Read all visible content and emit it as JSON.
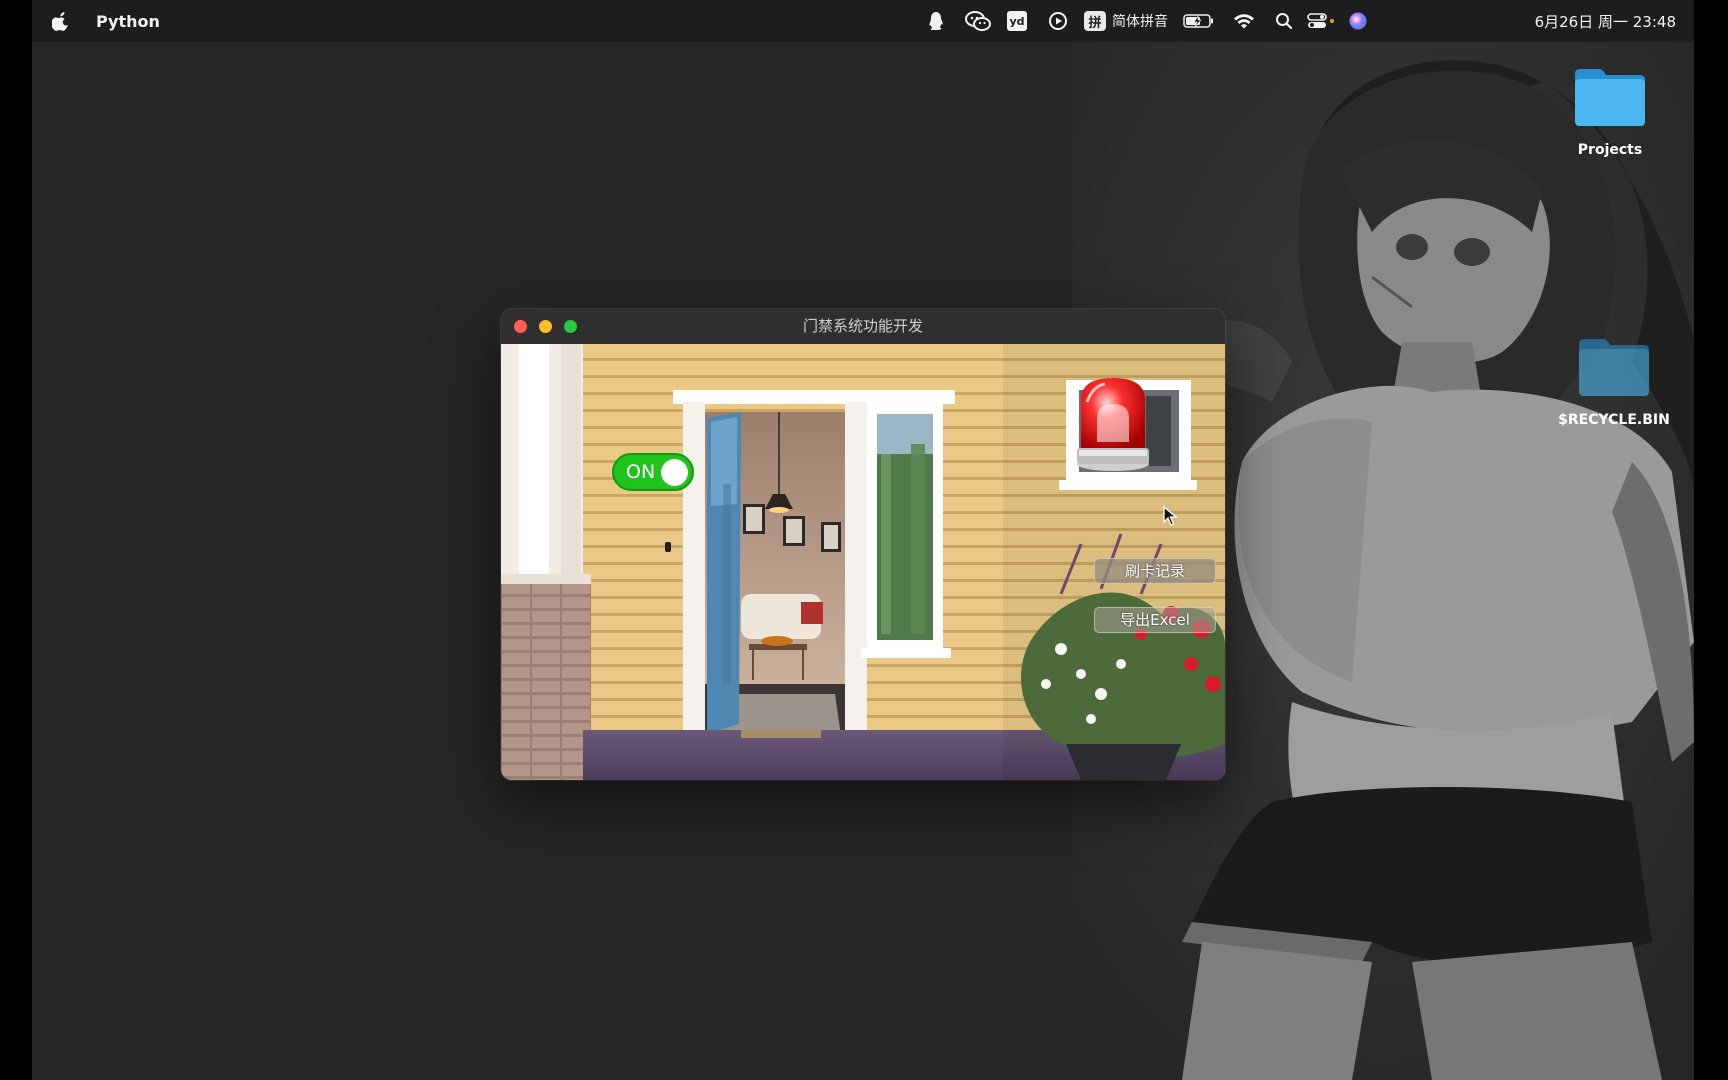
{
  "menubar": {
    "app_name": "Python",
    "ime_badge": "拼",
    "ime_label": "简体拼音",
    "clock": "6月26日 周一 23:48",
    "tray_icons": [
      "qq-icon",
      "wechat-icon",
      "youdao-icon",
      "play-icon",
      "ime-icon",
      "battery-icon",
      "wifi-icon",
      "search-icon",
      "control-center-icon",
      "siri-icon"
    ],
    "youdao_label": "yd"
  },
  "desktop": {
    "icons": [
      {
        "label": "Projects"
      },
      {
        "label": "$RECYCLE.BIN"
      }
    ]
  },
  "window": {
    "title": "门禁系统功能开发",
    "toggle_label": "ON",
    "toggle_state": "on",
    "buttons": {
      "record": "刷卡记录",
      "export": "导出Excel"
    }
  },
  "colors": {
    "desktop_bg": "#262626",
    "menubar_bg": "#1d1d1d",
    "toggle_on": "#1ec31e",
    "folder_blue": "#35a7e6",
    "alarm_red": "#e01010"
  }
}
